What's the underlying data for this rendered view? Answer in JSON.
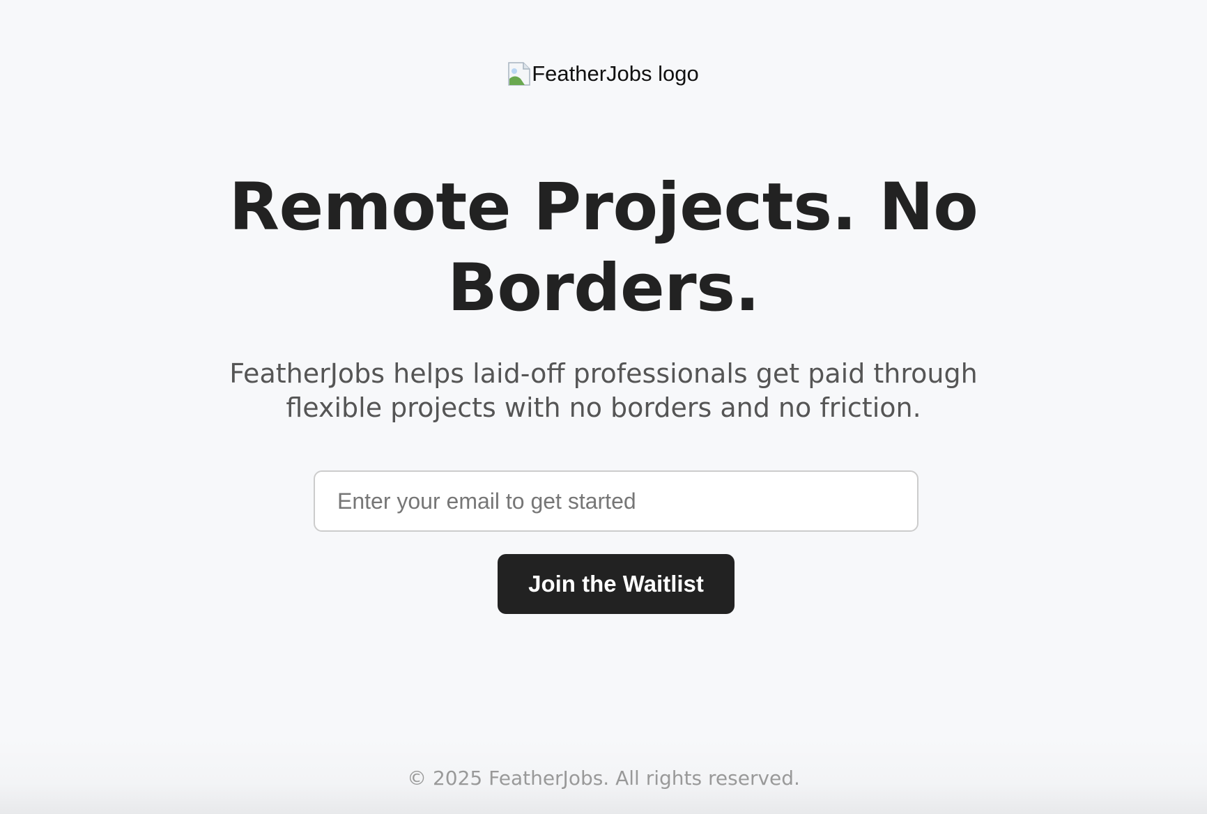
{
  "header": {
    "logo_alt": "FeatherJobs logo"
  },
  "hero": {
    "title_line1": "Remote Projects. No",
    "title_line2": "Borders.",
    "subtitle_line1": "FeatherJobs helps laid-off professionals get paid through",
    "subtitle_line2": "flexible projects with no borders and no friction."
  },
  "signup": {
    "email_placeholder": "Enter your email to get started",
    "email_value": "",
    "button_label": "Join the Waitlist"
  },
  "footer": {
    "copyright": "© 2025 FeatherJobs. All rights reserved."
  },
  "colors": {
    "background": "#f7f8fa",
    "text_primary": "#222222",
    "text_secondary": "#555555",
    "button_bg": "#222222",
    "button_text": "#ffffff",
    "footer_text": "#999999"
  },
  "icons": {
    "logo": "broken-image-icon"
  }
}
